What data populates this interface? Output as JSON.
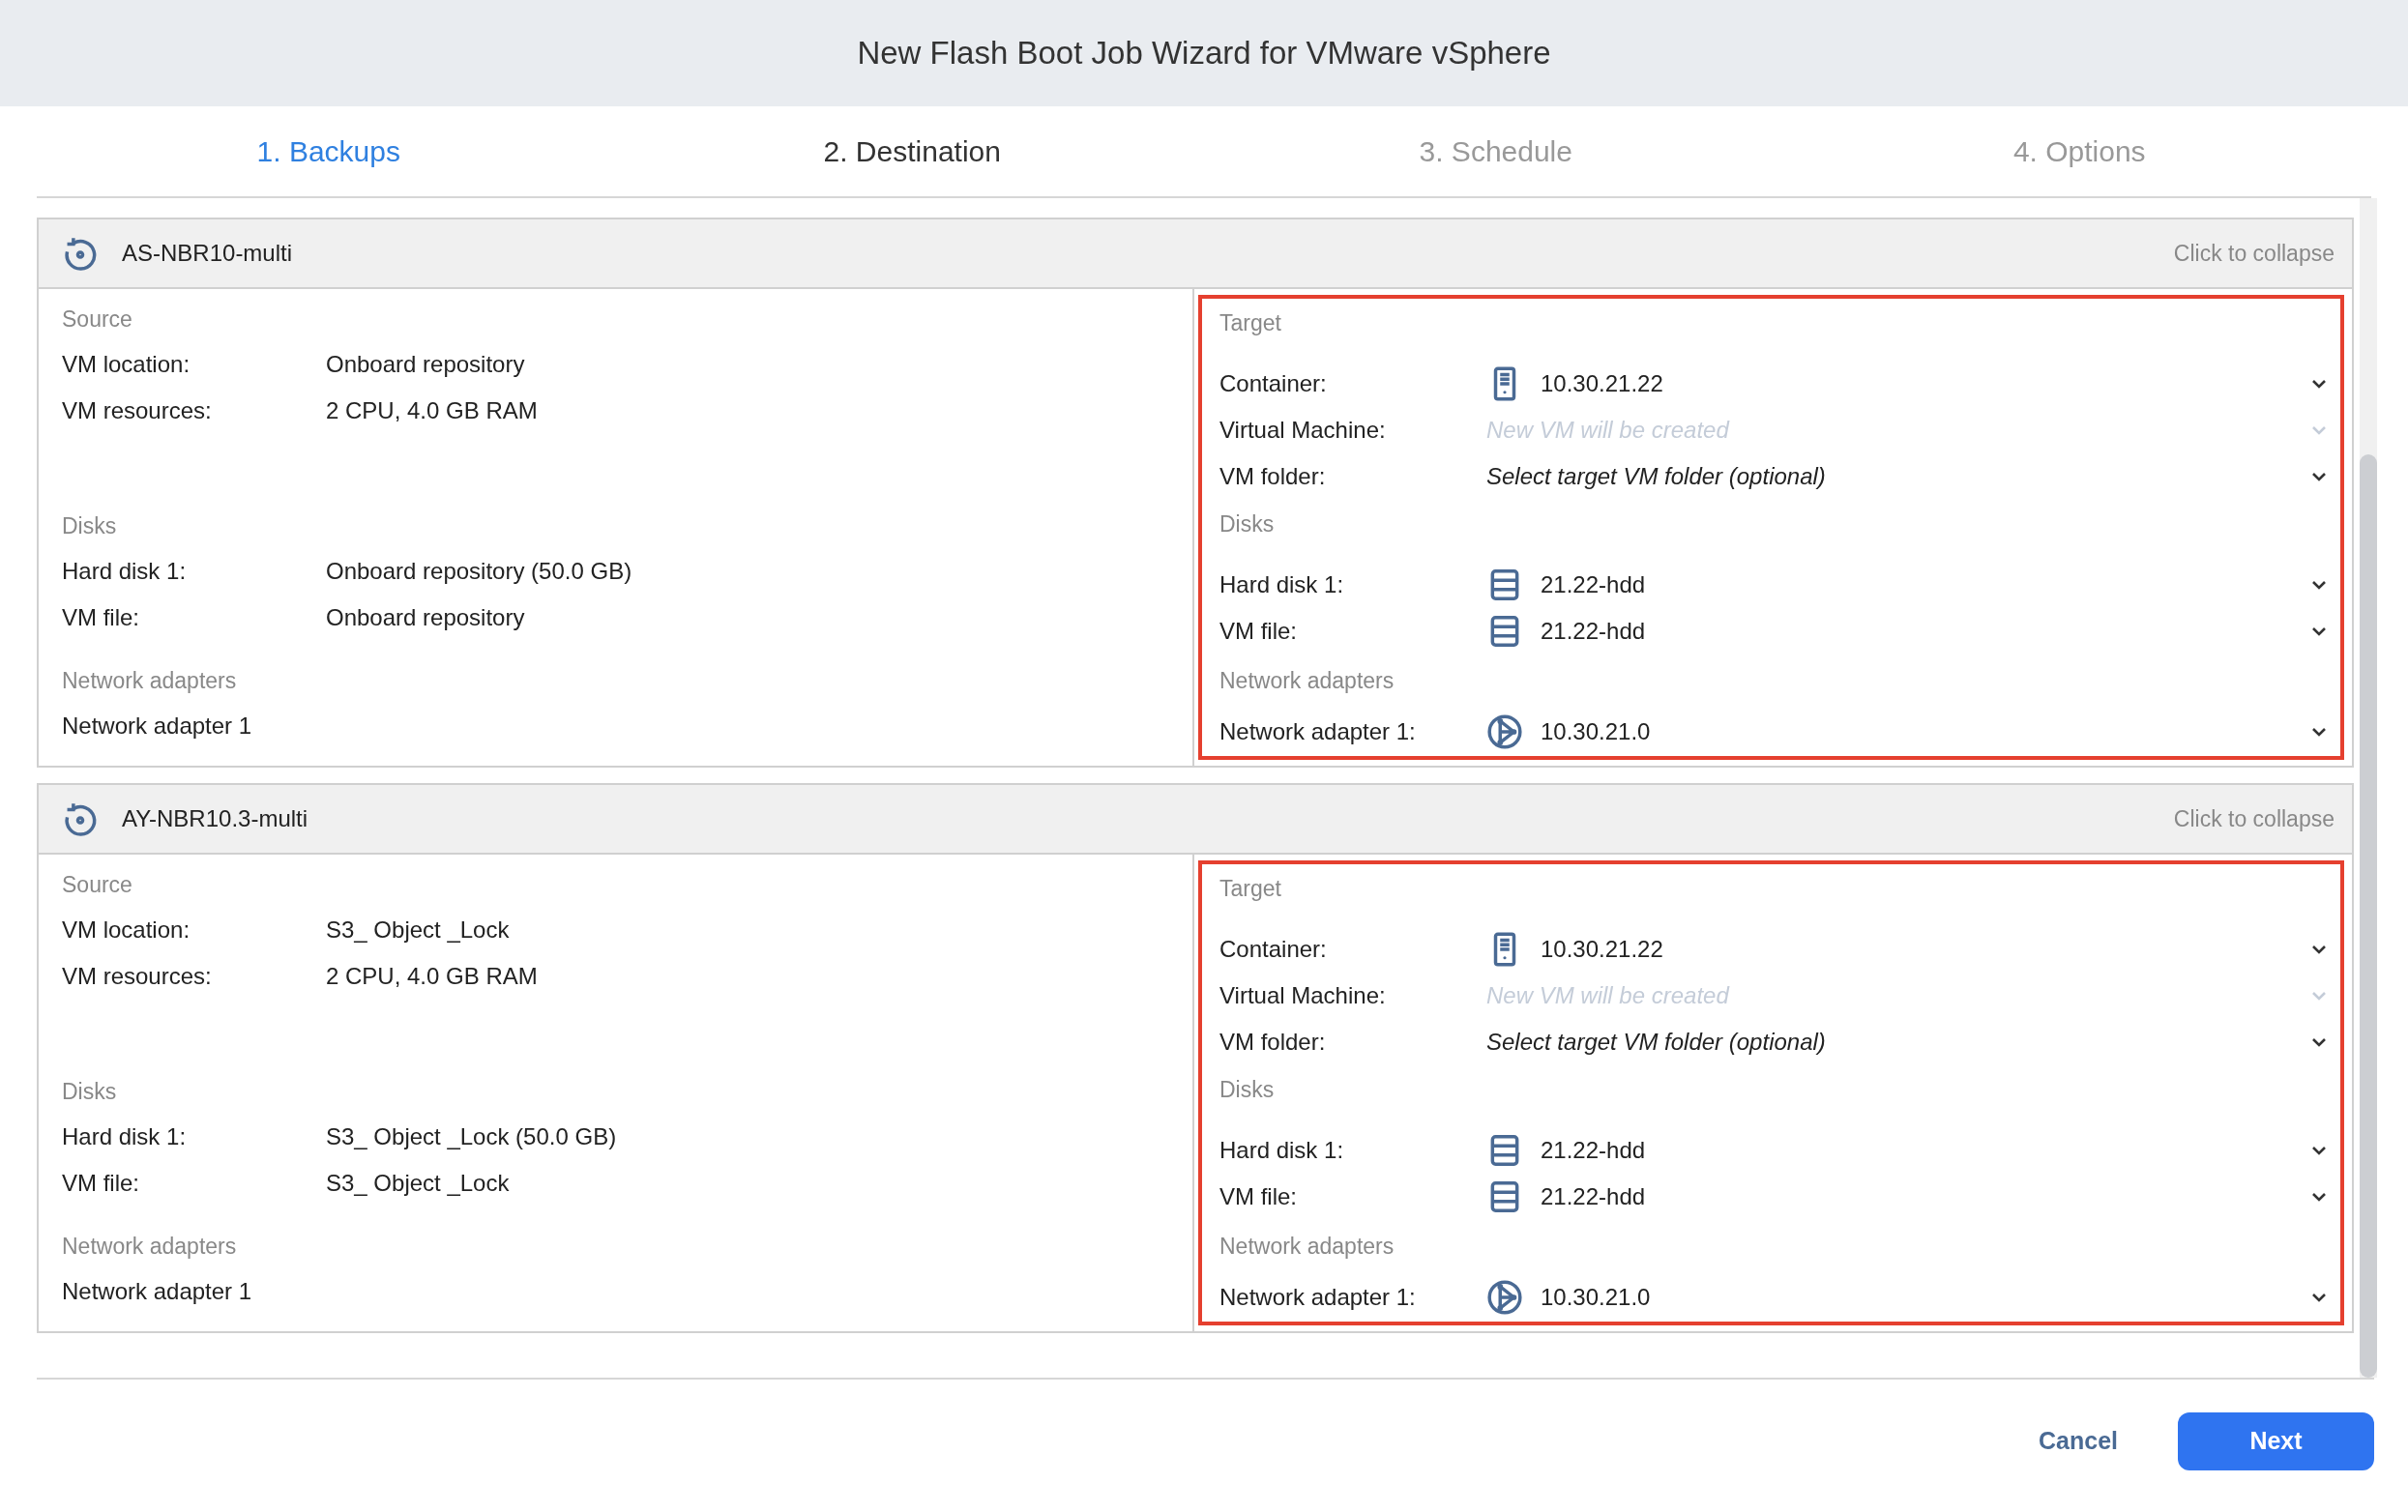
{
  "window": {
    "title": "New Flash Boot Job Wizard for VMware vSphere"
  },
  "tabs": [
    {
      "label": "1. Backups",
      "selected": true,
      "disabled": false
    },
    {
      "label": "2. Destination",
      "selected": false,
      "disabled": false
    },
    {
      "label": "3. Schedule",
      "selected": false,
      "disabled": true
    },
    {
      "label": "4. Options",
      "selected": false,
      "disabled": true
    }
  ],
  "backups": [
    {
      "name": "AS-NBR10-multi",
      "collapse_link": "Click to collapse",
      "highlighted": true,
      "source": [
        {
          "heading": "Source",
          "rows": [
            {
              "label": "VM location:",
              "value": "Onboard repository"
            },
            {
              "label": "VM resources:",
              "value": "2 CPU, 4.0 GB RAM"
            }
          ]
        },
        {
          "heading": "Disks",
          "rows": [
            {
              "label": "Hard disk 1:",
              "value": "Onboard repository (50.0 GB)"
            },
            {
              "label": "VM file:",
              "value": "Onboard repository"
            }
          ]
        },
        {
          "heading": "Network adapters",
          "rows": [
            {
              "label": "Network adapter 1"
            }
          ]
        }
      ],
      "target": [
        {
          "heading": "Target",
          "fields": [
            {
              "label": "Container:",
              "kind": "server",
              "value": "10.30.21.22",
              "disabled": false
            },
            {
              "label": "Virtual Machine:",
              "kind": "vm",
              "placeholder": "New VM will be created",
              "disabled": true
            },
            {
              "label": "VM folder:",
              "kind": "folder",
              "placeholder": "Select target VM folder (optional)",
              "disabled": false
            }
          ]
        },
        {
          "heading": "Disks",
          "fields": [
            {
              "label": "Hard disk 1:",
              "kind": "disk",
              "value": "21.22-hdd",
              "disabled": false
            },
            {
              "label": "VM file:",
              "kind": "disk",
              "value": "21.22-hdd",
              "disabled": false
            }
          ]
        },
        {
          "heading": "Network adapters",
          "fields": [
            {
              "label": "Network adapter 1:",
              "kind": "network",
              "value": "10.30.21.0",
              "disabled": false
            }
          ]
        }
      ]
    },
    {
      "name": "AY-NBR10.3-multi",
      "collapse_link": "Click to collapse",
      "highlighted": true,
      "source": [
        {
          "heading": "Source",
          "rows": [
            {
              "label": "VM location:",
              "value": "S3_ Object _Lock"
            },
            {
              "label": "VM resources:",
              "value": "2 CPU, 4.0 GB RAM"
            }
          ]
        },
        {
          "heading": "Disks",
          "rows": [
            {
              "label": "Hard disk 1:",
              "value": "S3_ Object _Lock (50.0 GB)"
            },
            {
              "label": "VM file:",
              "value": "S3_ Object _Lock"
            }
          ]
        },
        {
          "heading": "Network adapters",
          "rows": [
            {
              "label": "Network adapter 1"
            }
          ]
        }
      ],
      "target": [
        {
          "heading": "Target",
          "fields": [
            {
              "label": "Container:",
              "kind": "server",
              "value": "10.30.21.22",
              "disabled": false
            },
            {
              "label": "Virtual Machine:",
              "kind": "vm",
              "placeholder": "New VM will be created",
              "disabled": true
            },
            {
              "label": "VM folder:",
              "kind": "folder",
              "placeholder": "Select target VM folder (optional)",
              "disabled": false
            }
          ]
        },
        {
          "heading": "Disks",
          "fields": [
            {
              "label": "Hard disk 1:",
              "kind": "disk",
              "value": "21.22-hdd",
              "disabled": false
            },
            {
              "label": "VM file:",
              "kind": "disk",
              "value": "21.22-hdd",
              "disabled": false
            }
          ]
        },
        {
          "heading": "Network adapters",
          "fields": [
            {
              "label": "Network adapter 1:",
              "kind": "network",
              "value": "10.30.21.0",
              "disabled": false
            }
          ]
        }
      ]
    }
  ],
  "buttons": {
    "cancel": "Cancel",
    "next": "Next"
  }
}
